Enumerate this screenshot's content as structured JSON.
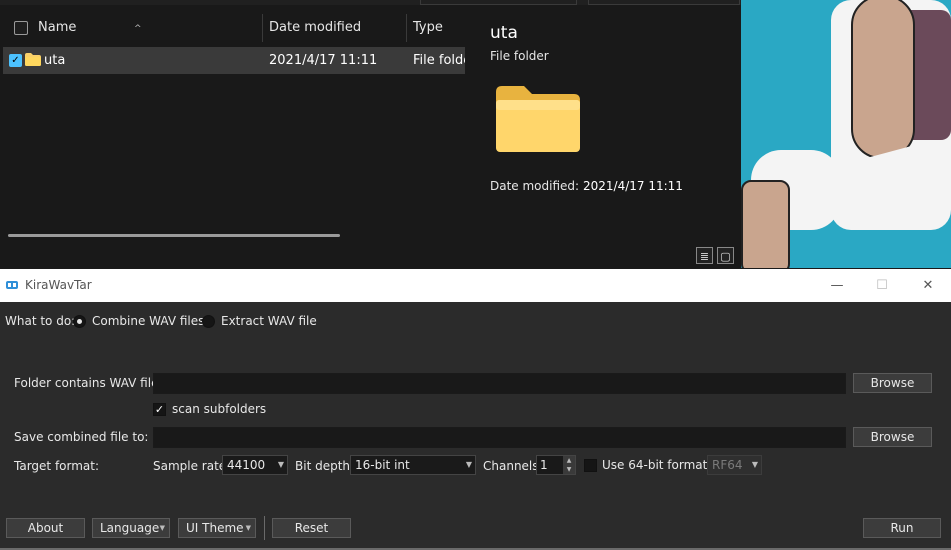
{
  "explorer": {
    "columns": {
      "name": "Name",
      "date_modified": "Date modified",
      "type": "Type"
    },
    "file": {
      "name": "uta",
      "date": "2021/4/17 11:11",
      "type": "File folder"
    },
    "details": {
      "title": "uta",
      "subtitle": "File folder",
      "date_label": "Date modified:",
      "date_value": "2021/4/17 11:11"
    },
    "colors": {
      "selection": "#3a3a3a",
      "checkbox_accent": "#4cc2ff",
      "folder": "#f9d06a"
    }
  },
  "kira": {
    "window_title": "KiraWavTar",
    "mode_label": "What to do:",
    "mode_options": [
      "Combine WAV files",
      "Extract WAV file"
    ],
    "mode_selected": "Combine WAV files",
    "folder_label": "Folder contains WAV files:",
    "folder_value": "",
    "browse_label": "Browse",
    "scan_subfolders_label": "scan subfolders",
    "scan_subfolders_checked": true,
    "save_label": "Save combined file to:",
    "save_value": "",
    "target_format_label": "Target format:",
    "sample_rate_label": "Sample rate",
    "sample_rate_value": "44100",
    "bit_depth_label": "Bit depth",
    "bit_depth_value": "16-bit int",
    "channels_label": "Channels",
    "channels_value": "1",
    "use64_label": "Use 64-bit format",
    "use64_checked": false,
    "rf64_value": "RF64",
    "buttons": {
      "about": "About",
      "language": "Language",
      "ui_theme": "UI Theme",
      "reset": "Reset",
      "run": "Run"
    }
  }
}
